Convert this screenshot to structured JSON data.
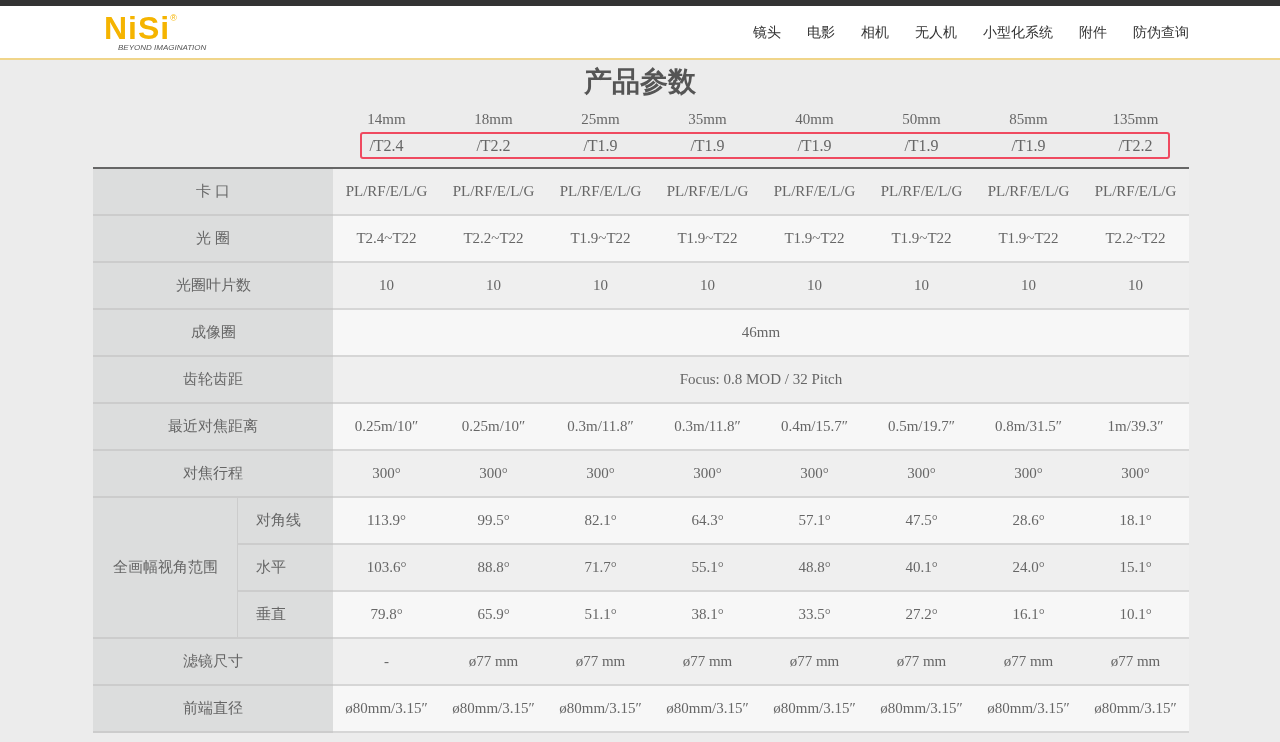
{
  "header": {
    "logo": {
      "wordmark": "NiSi",
      "registered": "®",
      "tagline": "BEYOND IMAGINATION"
    },
    "nav": [
      {
        "label": "镜头"
      },
      {
        "label": "电影"
      },
      {
        "label": "相机"
      },
      {
        "label": "无人机"
      },
      {
        "label": "小型化系统"
      },
      {
        "label": "附件"
      },
      {
        "label": "防伪查询"
      }
    ]
  },
  "title": "产品参数",
  "lenses": [
    {
      "focal": "14mm",
      "aperture": "/T2.4"
    },
    {
      "focal": "18mm",
      "aperture": "/T2.2"
    },
    {
      "focal": "25mm",
      "aperture": "/T1.9"
    },
    {
      "focal": "35mm",
      "aperture": "/T1.9"
    },
    {
      "focal": "40mm",
      "aperture": "/T1.9"
    },
    {
      "focal": "50mm",
      "aperture": "/T1.9"
    },
    {
      "focal": "85mm",
      "aperture": "/T1.9"
    },
    {
      "focal": "135mm",
      "aperture": "/T2.2"
    }
  ],
  "specs": [
    {
      "label": "卡 口",
      "values": [
        "PL/RF/E/L/G",
        "PL/RF/E/L/G",
        "PL/RF/E/L/G",
        "PL/RF/E/L/G",
        "PL/RF/E/L/G",
        "PL/RF/E/L/G",
        "PL/RF/E/L/G",
        "PL/RF/E/L/G"
      ]
    },
    {
      "label": "光 圈",
      "values": [
        "T2.4~T22",
        "T2.2~T22",
        "T1.9~T22",
        "T1.9~T22",
        "T1.9~T22",
        "T1.9~T22",
        "T1.9~T22",
        "T2.2~T22"
      ]
    },
    {
      "label": "光圈叶片数",
      "values": [
        "10",
        "10",
        "10",
        "10",
        "10",
        "10",
        "10",
        "10"
      ]
    },
    {
      "label": "成像圈",
      "values": [
        "46mm"
      ]
    },
    {
      "label": "齿轮齿距",
      "values": [
        "Focus: 0.8 MOD / 32 Pitch"
      ]
    },
    {
      "label": "最近对焦距离",
      "values": [
        "0.25m/10″",
        "0.25m/10″",
        "0.3m/11.8″",
        "0.3m/11.8″",
        "0.4m/15.7″",
        "0.5m/19.7″",
        "0.8m/31.5″",
        "1m/39.3″"
      ]
    },
    {
      "label": "对焦行程",
      "values": [
        "300°",
        "300°",
        "300°",
        "300°",
        "300°",
        "300°",
        "300°",
        "300°"
      ]
    },
    {
      "label": "全画幅视角范围",
      "children": [
        {
          "label": "对角线",
          "values": [
            "113.9°",
            "99.5°",
            "82.1°",
            "64.3°",
            "57.1°",
            "47.5°",
            "28.6°",
            "18.1°"
          ]
        },
        {
          "label": "水平",
          "values": [
            "103.6°",
            "88.8°",
            "71.7°",
            "55.1°",
            "48.8°",
            "40.1°",
            "24.0°",
            "15.1°"
          ]
        },
        {
          "label": "垂直",
          "values": [
            "79.8°",
            "65.9°",
            "51.1°",
            "38.1°",
            "33.5°",
            "27.2°",
            "16.1°",
            "10.1°"
          ]
        }
      ]
    },
    {
      "label": "滤镜尺寸",
      "values": [
        "-",
        "ø77 mm",
        "ø77 mm",
        "ø77 mm",
        "ø77 mm",
        "ø77 mm",
        "ø77 mm",
        "ø77 mm"
      ]
    },
    {
      "label": "前端直径",
      "values": [
        "ø80mm/3.15″",
        "ø80mm/3.15″",
        "ø80mm/3.15″",
        "ø80mm/3.15″",
        "ø80mm/3.15″",
        "ø80mm/3.15″",
        "ø80mm/3.15″",
        "ø80mm/3.15″"
      ]
    }
  ]
}
